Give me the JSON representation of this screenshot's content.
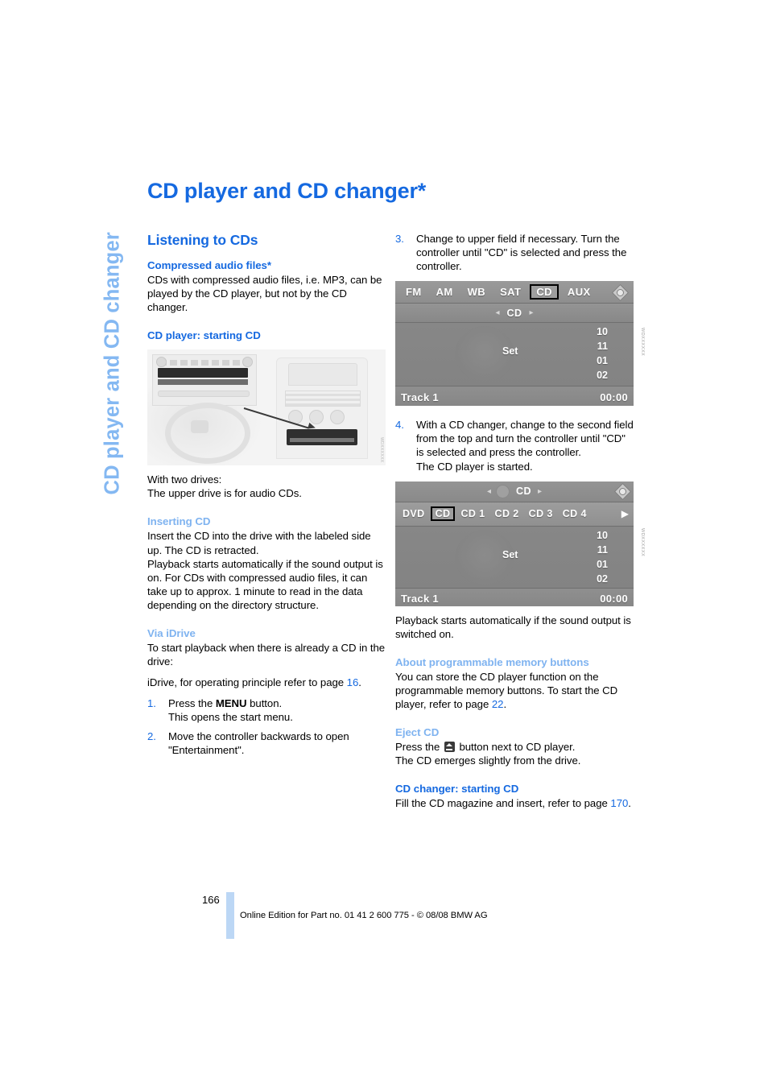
{
  "side_tab": {
    "label": "CD player and CD changer"
  },
  "page_title": "CD player and CD changer*",
  "left_column": {
    "section_heading": "Listening to CDs",
    "compressed": {
      "heading": "Compressed audio files*",
      "text": "CDs with compressed audio files, i.e. MP3, can be played by the CD player, but not by the CD changer."
    },
    "cd_player_starting": {
      "heading": "CD player: starting CD",
      "figure_code": "WDXXXXXX"
    },
    "two_drives": {
      "line1": "With two drives:",
      "line2": "The upper drive is for audio CDs."
    },
    "inserting": {
      "heading": "Inserting CD",
      "para1": "Insert the CD into the drive with the labeled side up. The CD is retracted.",
      "para2": "Playback starts automatically if the sound output is on. For CDs with compressed audio files, it can take up to approx. 1 minute to read in the data depending on the directory structure."
    },
    "via_idrive": {
      "heading": "Via iDrive",
      "intro": "To start playback when there is already a CD in the drive:",
      "idrive_ref_prefix": "iDrive, for operating principle refer to page ",
      "idrive_ref_page": "16",
      "idrive_ref_suffix": ".",
      "steps": [
        {
          "num": "1.",
          "text_before": "Press the ",
          "bold": "MENU",
          "text_after": " button.",
          "subline": "This opens the start menu."
        },
        {
          "num": "2.",
          "text": "Move the controller backwards to open \"Entertainment\"."
        }
      ]
    }
  },
  "right_column": {
    "step3": {
      "num": "3.",
      "text": "Change to upper field if necessary. Turn the controller until \"CD\" is selected and press the controller."
    },
    "screen1": {
      "tabs": [
        "FM",
        "AM",
        "WB",
        "SAT",
        "CD",
        "AUX"
      ],
      "selected_tab": "CD",
      "sub_label": "CD",
      "arrow_left": "◂",
      "arrow_right": "▸",
      "set_label": "Set",
      "numbers": [
        "10",
        "11",
        "01",
        "02"
      ],
      "track_label": "Track 1",
      "time": "00:00",
      "figure_code": "WDXXXXXX"
    },
    "step4": {
      "num": "4.",
      "text": "With a CD changer, change to the second field from the top and turn the controller until \"CD\" is selected and press the controller.",
      "subline": "The CD player is started."
    },
    "screen2": {
      "top_label": "CD",
      "arrow_left": "◂",
      "arrow_right": "▸",
      "tabs": [
        "DVD",
        "CD",
        "CD 1",
        "CD 2",
        "CD 3",
        "CD 4"
      ],
      "selected_tab": "CD",
      "next_arrow": "▶",
      "set_label": "Set",
      "numbers": [
        "10",
        "11",
        "01",
        "02"
      ],
      "track_label": "Track 1",
      "time": "00:00",
      "figure_code": "WDXXXXXX"
    },
    "playback_note": "Playback starts automatically if the sound output is switched on.",
    "memory_buttons": {
      "heading": "About programmable memory buttons",
      "text_before": "You can store the CD player function on the programmable memory buttons. To start the CD player, refer to page ",
      "page": "22",
      "text_after": "."
    },
    "eject": {
      "heading": "Eject CD",
      "text_before": "Press the ",
      "icon": "eject-icon",
      "text_after": " button next to CD player.",
      "subline": "The CD emerges slightly from the drive."
    },
    "changer_starting": {
      "heading": "CD changer: starting CD",
      "text_before": "Fill the CD magazine and insert, refer to page ",
      "page": "170",
      "text_after": "."
    }
  },
  "footer": {
    "page_number": "166",
    "text": "Online Edition for Part no. 01 41 2 600 775 - © 08/08 BMW AG"
  },
  "colors": {
    "heading_blue": "#1569e0",
    "light_blue": "#7fb3f0",
    "footer_bar": "#bcd7f5"
  }
}
